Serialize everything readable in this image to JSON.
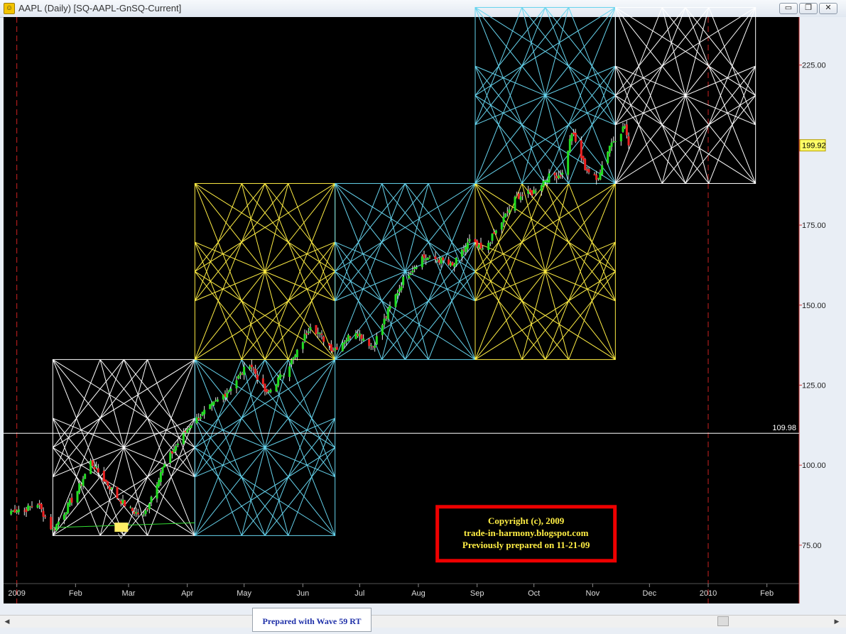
{
  "window": {
    "title": "AAPL (Daily) [SQ-AAPL-GnSQ-Current]",
    "minimize_glyph": "▭",
    "restore_glyph": "❐",
    "close_glyph": "✕"
  },
  "footer": {
    "text": "Prepared with Wave 59 RT"
  },
  "scroll": {
    "left_glyph": "◀",
    "right_glyph": "▶"
  },
  "colors": {
    "background": "#000000",
    "up_candle": "#22dd22",
    "down_candle": "#ee2222",
    "square_white": "#ffffff",
    "square_yellow": "#ffee44",
    "square_cyan": "#66d4ee",
    "time_marker": "#cc2222",
    "copyright_border": "#ee0000",
    "copyright_text": "#ffee44"
  },
  "chart_data": {
    "type": "candlestick",
    "symbol": "AAPL",
    "interval": "Daily",
    "ylim": [
      63,
      240
    ],
    "xlim": [
      "2008-12-25",
      "2010-02-18"
    ],
    "y_ticks": [
      75,
      100,
      125,
      150,
      175,
      225
    ],
    "y_tick_labels": [
      "75.00",
      "100.00",
      "125.00",
      "150.00",
      "175.00",
      "225.00"
    ],
    "x_tick_labels": [
      {
        "date": "2009-01-01",
        "label": "2009"
      },
      {
        "date": "2009-02-01",
        "label": "Feb"
      },
      {
        "date": "2009-03-01",
        "label": "Mar"
      },
      {
        "date": "2009-04-01",
        "label": "Apr"
      },
      {
        "date": "2009-05-01",
        "label": "May"
      },
      {
        "date": "2009-06-01",
        "label": "Jun"
      },
      {
        "date": "2009-07-01",
        "label": "Jul"
      },
      {
        "date": "2009-08-01",
        "label": "Aug"
      },
      {
        "date": "2009-09-01",
        "label": "Sep"
      },
      {
        "date": "2009-10-01",
        "label": "Oct"
      },
      {
        "date": "2009-11-01",
        "label": "Nov"
      },
      {
        "date": "2009-12-01",
        "label": "Dec"
      },
      {
        "date": "2010-01-01",
        "label": "2010"
      },
      {
        "date": "2010-02-01",
        "label": "Feb"
      }
    ],
    "vertical_markers": [
      "2009-01-01",
      "2010-01-01"
    ],
    "horizontal_level": {
      "value": 109.98,
      "label": "109.98"
    },
    "last_price": {
      "value": 199.92,
      "label": "199.92"
    },
    "anchor_points": [
      [
        "2009-01-05",
        86
      ],
      [
        "2009-01-12",
        88
      ],
      [
        "2009-01-20",
        79.5
      ],
      [
        "2009-02-02",
        92
      ],
      [
        "2009-02-09",
        101
      ],
      [
        "2009-02-23",
        90
      ],
      [
        "2009-03-02",
        86
      ],
      [
        "2009-03-09",
        84
      ],
      [
        "2009-03-18",
        98
      ],
      [
        "2009-03-26",
        106
      ],
      [
        "2009-04-03",
        113
      ],
      [
        "2009-04-13",
        118
      ],
      [
        "2009-04-22",
        123
      ],
      [
        "2009-05-04",
        132
      ],
      [
        "2009-05-13",
        122
      ],
      [
        "2009-05-28",
        134
      ],
      [
        "2009-06-05",
        144
      ],
      [
        "2009-06-17",
        136
      ],
      [
        "2009-06-29",
        142
      ],
      [
        "2009-07-08",
        137
      ],
      [
        "2009-07-16",
        148
      ],
      [
        "2009-07-24",
        158
      ],
      [
        "2009-08-03",
        165
      ],
      [
        "2009-08-13",
        164
      ],
      [
        "2009-08-19",
        162
      ],
      [
        "2009-08-28",
        170
      ],
      [
        "2009-09-04",
        167
      ],
      [
        "2009-09-11",
        173
      ],
      [
        "2009-09-22",
        184
      ],
      [
        "2009-09-30",
        185
      ],
      [
        "2009-10-08",
        190
      ],
      [
        "2009-10-16",
        191
      ],
      [
        "2009-10-21",
        204
      ],
      [
        "2009-10-28",
        193
      ],
      [
        "2009-11-03",
        189
      ],
      [
        "2009-11-10",
        200
      ],
      [
        "2009-11-18",
        206
      ],
      [
        "2009-11-20",
        199.92
      ]
    ],
    "squares": [
      {
        "start": "2009-01-20",
        "end": "2009-04-05",
        "low": 78,
        "high": 133,
        "color": "white"
      },
      {
        "start": "2009-04-05",
        "end": "2009-06-18",
        "low": 78,
        "high": 133,
        "color": "cyan"
      },
      {
        "start": "2009-04-05",
        "end": "2009-06-18",
        "low": 133,
        "high": 188,
        "color": "yellow"
      },
      {
        "start": "2009-06-18",
        "end": "2009-08-31",
        "low": 133,
        "high": 188,
        "color": "cyan"
      },
      {
        "start": "2009-08-31",
        "end": "2009-11-13",
        "low": 133,
        "high": 188,
        "color": "yellow"
      },
      {
        "start": "2009-08-31",
        "end": "2009-11-13",
        "low": 188,
        "high": 243,
        "color": "cyan"
      },
      {
        "start": "2009-11-13",
        "end": "2010-01-26",
        "low": 188,
        "high": 243,
        "color": "white"
      }
    ],
    "trend_line": {
      "points": [
        [
          "2009-01-20",
          80.5
        ],
        [
          "2009-04-05",
          82
        ]
      ],
      "marker_date": "2009-02-25"
    },
    "copyright_box": {
      "lines": [
        "Copyright (c), 2009",
        "trade-in-harmony.blogspot.com",
        "Previously prepared on 11-21-09"
      ]
    }
  }
}
